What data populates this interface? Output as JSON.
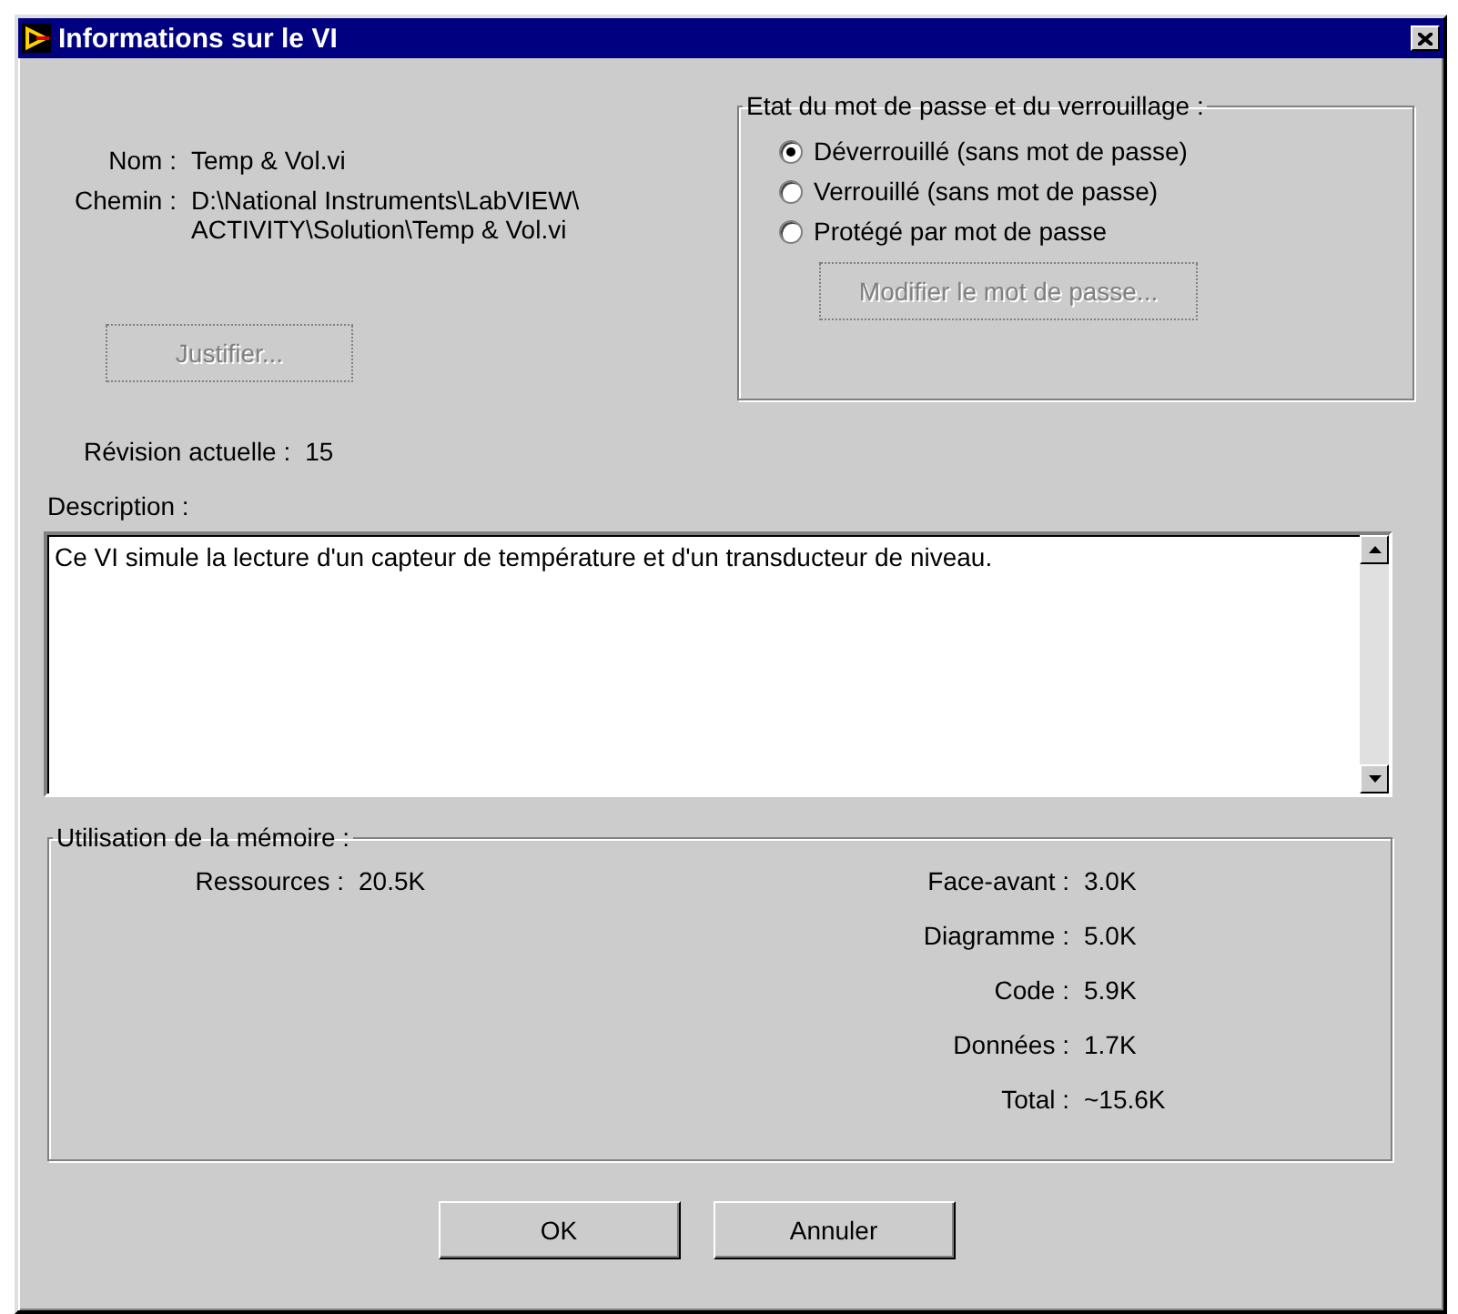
{
  "window": {
    "title": "Informations sur le VI"
  },
  "fields": [
    {
      "label": "Nom :",
      "lines": [
        "Temp & Vol.vi"
      ]
    },
    {
      "label": "Chemin :",
      "lines": [
        "D:\\National Instruments\\LabVIEW\\",
        "ACTIVITY\\Solution\\Temp & Vol.vi"
      ]
    }
  ],
  "justify_button": {
    "label": "Justifier...",
    "disabled": true
  },
  "revision": {
    "label": "Révision actuelle :",
    "value": "15"
  },
  "lock_group": {
    "title": "Etat du mot de passe et du verrouillage :",
    "options": [
      {
        "label": "Déverrouillé (sans mot de passe)",
        "selected": true
      },
      {
        "label": "Verrouillé (sans mot de passe)",
        "selected": false
      },
      {
        "label": "Protégé par mot de passe",
        "selected": false
      }
    ],
    "change_password_button": {
      "label": "Modifier le mot de passe...",
      "disabled": true
    }
  },
  "description": {
    "label": "Description :",
    "value": "Ce VI simule la lecture d'un capteur de température et d'un transducteur de niveau."
  },
  "memory": {
    "title": "Utilisation de la mémoire :",
    "left": [
      {
        "label": "Ressources :",
        "value": "20.5K"
      }
    ],
    "right": [
      {
        "label": "Face-avant :",
        "value": "3.0K"
      },
      {
        "label": "Diagramme :",
        "value": "5.0K"
      },
      {
        "label": "Code :",
        "value": "5.9K"
      },
      {
        "label": "Données :",
        "value": "1.7K"
      },
      {
        "label": "Total :",
        "value": "~15.6K"
      }
    ]
  },
  "buttons": [
    {
      "label": "OK"
    },
    {
      "label": "Annuler"
    }
  ]
}
